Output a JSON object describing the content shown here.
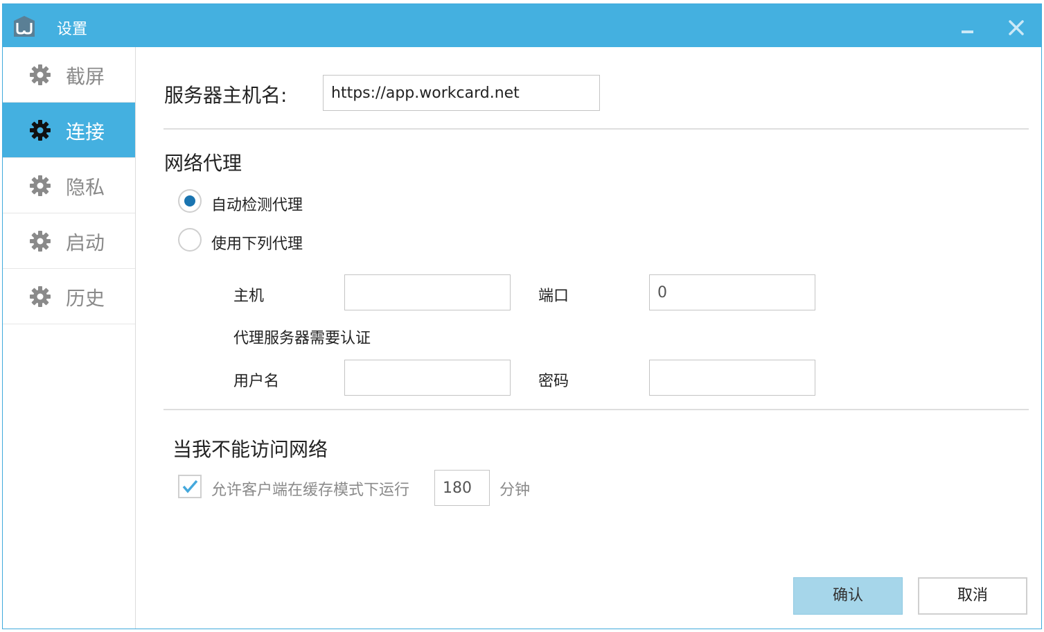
{
  "window": {
    "title": "设置"
  },
  "sidebar": {
    "items": [
      {
        "label": "截屏",
        "active": false
      },
      {
        "label": "连接",
        "active": true
      },
      {
        "label": "隐私",
        "active": false
      },
      {
        "label": "启动",
        "active": false
      },
      {
        "label": "历史",
        "active": false
      }
    ]
  },
  "server": {
    "label": "服务器主机名:",
    "value": "https://app.workcard.net"
  },
  "proxy": {
    "title": "网络代理",
    "auto_label": "自动检测代理",
    "manual_label": "使用下列代理",
    "selected": "auto",
    "host_label": "主机",
    "host_value": "",
    "port_label": "端口",
    "port_value": "0",
    "auth_label": "代理服务器需要认证",
    "username_label": "用户名",
    "username_value": "",
    "password_label": "密码",
    "password_value": ""
  },
  "offline": {
    "title": "当我不能访问网络",
    "checkbox_label": "允许客户端在缓存模式下运行",
    "checked": true,
    "minutes_value": "180",
    "minutes_unit": "分钟"
  },
  "buttons": {
    "ok": "确认",
    "cancel": "取消"
  },
  "colors": {
    "accent": "#44b0e0",
    "radio_dot": "#1a74b0",
    "ok_button": "#a6d6ea"
  }
}
